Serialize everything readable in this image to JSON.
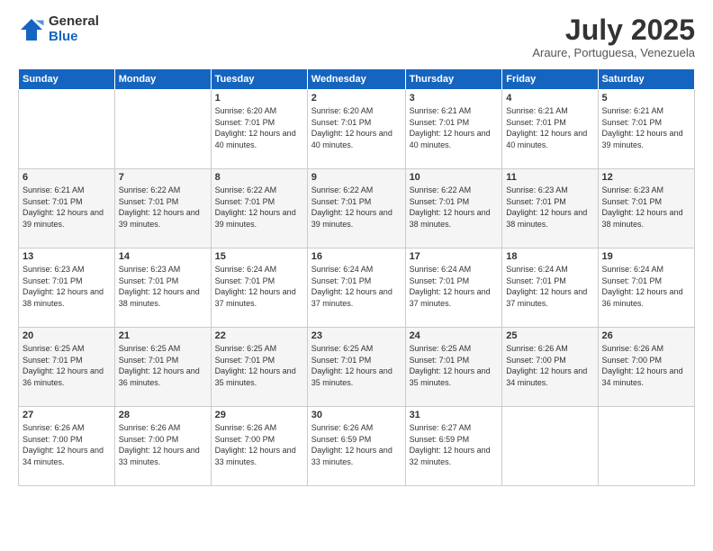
{
  "logo": {
    "general": "General",
    "blue": "Blue"
  },
  "header": {
    "month": "July 2025",
    "location": "Araure, Portuguesa, Venezuela"
  },
  "weekdays": [
    "Sunday",
    "Monday",
    "Tuesday",
    "Wednesday",
    "Thursday",
    "Friday",
    "Saturday"
  ],
  "weeks": [
    [
      {
        "day": "",
        "info": ""
      },
      {
        "day": "",
        "info": ""
      },
      {
        "day": "1",
        "info": "Sunrise: 6:20 AM\nSunset: 7:01 PM\nDaylight: 12 hours and 40 minutes."
      },
      {
        "day": "2",
        "info": "Sunrise: 6:20 AM\nSunset: 7:01 PM\nDaylight: 12 hours and 40 minutes."
      },
      {
        "day": "3",
        "info": "Sunrise: 6:21 AM\nSunset: 7:01 PM\nDaylight: 12 hours and 40 minutes."
      },
      {
        "day": "4",
        "info": "Sunrise: 6:21 AM\nSunset: 7:01 PM\nDaylight: 12 hours and 40 minutes."
      },
      {
        "day": "5",
        "info": "Sunrise: 6:21 AM\nSunset: 7:01 PM\nDaylight: 12 hours and 39 minutes."
      }
    ],
    [
      {
        "day": "6",
        "info": "Sunrise: 6:21 AM\nSunset: 7:01 PM\nDaylight: 12 hours and 39 minutes."
      },
      {
        "day": "7",
        "info": "Sunrise: 6:22 AM\nSunset: 7:01 PM\nDaylight: 12 hours and 39 minutes."
      },
      {
        "day": "8",
        "info": "Sunrise: 6:22 AM\nSunset: 7:01 PM\nDaylight: 12 hours and 39 minutes."
      },
      {
        "day": "9",
        "info": "Sunrise: 6:22 AM\nSunset: 7:01 PM\nDaylight: 12 hours and 39 minutes."
      },
      {
        "day": "10",
        "info": "Sunrise: 6:22 AM\nSunset: 7:01 PM\nDaylight: 12 hours and 38 minutes."
      },
      {
        "day": "11",
        "info": "Sunrise: 6:23 AM\nSunset: 7:01 PM\nDaylight: 12 hours and 38 minutes."
      },
      {
        "day": "12",
        "info": "Sunrise: 6:23 AM\nSunset: 7:01 PM\nDaylight: 12 hours and 38 minutes."
      }
    ],
    [
      {
        "day": "13",
        "info": "Sunrise: 6:23 AM\nSunset: 7:01 PM\nDaylight: 12 hours and 38 minutes."
      },
      {
        "day": "14",
        "info": "Sunrise: 6:23 AM\nSunset: 7:01 PM\nDaylight: 12 hours and 38 minutes."
      },
      {
        "day": "15",
        "info": "Sunrise: 6:24 AM\nSunset: 7:01 PM\nDaylight: 12 hours and 37 minutes."
      },
      {
        "day": "16",
        "info": "Sunrise: 6:24 AM\nSunset: 7:01 PM\nDaylight: 12 hours and 37 minutes."
      },
      {
        "day": "17",
        "info": "Sunrise: 6:24 AM\nSunset: 7:01 PM\nDaylight: 12 hours and 37 minutes."
      },
      {
        "day": "18",
        "info": "Sunrise: 6:24 AM\nSunset: 7:01 PM\nDaylight: 12 hours and 37 minutes."
      },
      {
        "day": "19",
        "info": "Sunrise: 6:24 AM\nSunset: 7:01 PM\nDaylight: 12 hours and 36 minutes."
      }
    ],
    [
      {
        "day": "20",
        "info": "Sunrise: 6:25 AM\nSunset: 7:01 PM\nDaylight: 12 hours and 36 minutes."
      },
      {
        "day": "21",
        "info": "Sunrise: 6:25 AM\nSunset: 7:01 PM\nDaylight: 12 hours and 36 minutes."
      },
      {
        "day": "22",
        "info": "Sunrise: 6:25 AM\nSunset: 7:01 PM\nDaylight: 12 hours and 35 minutes."
      },
      {
        "day": "23",
        "info": "Sunrise: 6:25 AM\nSunset: 7:01 PM\nDaylight: 12 hours and 35 minutes."
      },
      {
        "day": "24",
        "info": "Sunrise: 6:25 AM\nSunset: 7:01 PM\nDaylight: 12 hours and 35 minutes."
      },
      {
        "day": "25",
        "info": "Sunrise: 6:26 AM\nSunset: 7:00 PM\nDaylight: 12 hours and 34 minutes."
      },
      {
        "day": "26",
        "info": "Sunrise: 6:26 AM\nSunset: 7:00 PM\nDaylight: 12 hours and 34 minutes."
      }
    ],
    [
      {
        "day": "27",
        "info": "Sunrise: 6:26 AM\nSunset: 7:00 PM\nDaylight: 12 hours and 34 minutes."
      },
      {
        "day": "28",
        "info": "Sunrise: 6:26 AM\nSunset: 7:00 PM\nDaylight: 12 hours and 33 minutes."
      },
      {
        "day": "29",
        "info": "Sunrise: 6:26 AM\nSunset: 7:00 PM\nDaylight: 12 hours and 33 minutes."
      },
      {
        "day": "30",
        "info": "Sunrise: 6:26 AM\nSunset: 6:59 PM\nDaylight: 12 hours and 33 minutes."
      },
      {
        "day": "31",
        "info": "Sunrise: 6:27 AM\nSunset: 6:59 PM\nDaylight: 12 hours and 32 minutes."
      },
      {
        "day": "",
        "info": ""
      },
      {
        "day": "",
        "info": ""
      }
    ]
  ]
}
